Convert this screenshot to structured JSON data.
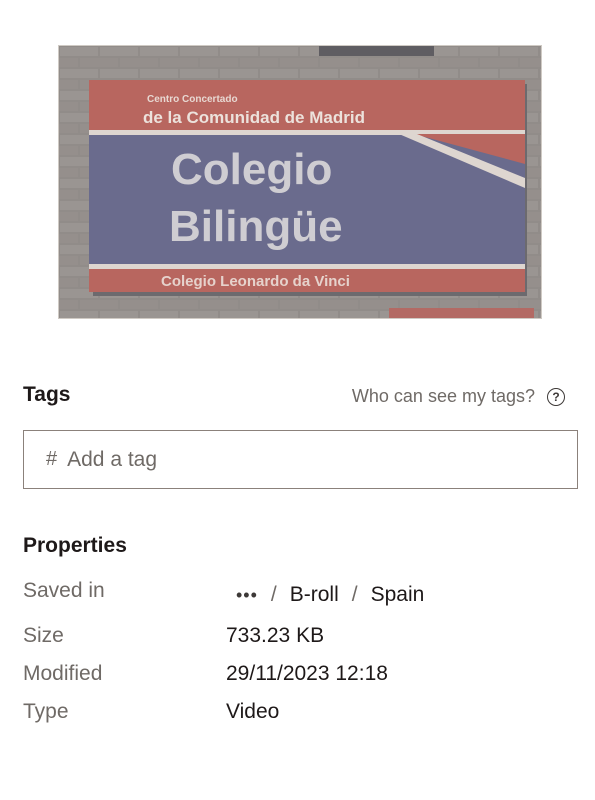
{
  "thumbnail": {
    "sign_small": "Centro Concertado",
    "sign_region": "de la Comunidad de Madrid",
    "sign_line1": "Colegio",
    "sign_line2": "Bilingüe",
    "sign_bottom": "Colegio Leonardo da Vinci"
  },
  "tags": {
    "title": "Tags",
    "who_can_see": "Who can see my tags?",
    "help_glyph": "?",
    "hash": "#",
    "placeholder": "Add a tag"
  },
  "properties": {
    "title": "Properties",
    "saved_in_label": "Saved in",
    "path": {
      "more": "•••",
      "sep": "/",
      "crumbs": [
        "B-roll",
        "Spain"
      ]
    },
    "size_label": "Size",
    "size_value": "733.23 KB",
    "modified_label": "Modified",
    "modified_value": "29/11/2023 12:18",
    "type_label": "Type",
    "type_value": "Video"
  },
  "icons": {
    "help": "help-circle-icon",
    "more": "more-horizontal-icon"
  }
}
